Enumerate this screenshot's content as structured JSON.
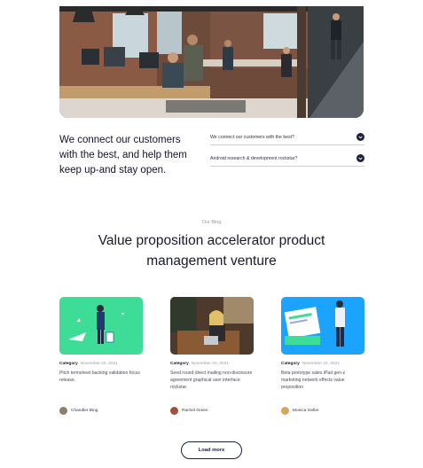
{
  "intro": {
    "heading": "We connect our customers with the best, and help them keep up-and stay open."
  },
  "faq": {
    "items": [
      {
        "question": "We connect our customers with the best?"
      },
      {
        "question": "Android research & development rockstar?"
      }
    ]
  },
  "blog": {
    "tag": "Our Blog",
    "title": "Value proposition accelerator product management venture",
    "cards": [
      {
        "category": "Category",
        "date": "November 22, 2021",
        "description": "Pitch termsheet backing validation focus release.",
        "author": "Chandler Bing",
        "thumb_color": "#3ddc97"
      },
      {
        "category": "Category",
        "date": "November 22, 2021",
        "description": "Seed round direct mailing non-disclosure agreement graphical user interface rockstar.",
        "author": "Rachel Green",
        "thumb_color": "#6b4a32"
      },
      {
        "category": "Category",
        "date": "November 22, 2021",
        "description": "Beta prototype sales iPad gen-z marketing network effects value proposition",
        "author": "Monica Geller",
        "thumb_color": "#1aa3ff"
      }
    ],
    "load_more_label": "Load more"
  },
  "colors": {
    "accent_dark": "#1b1f3b",
    "text_muted": "#9a9aa8"
  }
}
